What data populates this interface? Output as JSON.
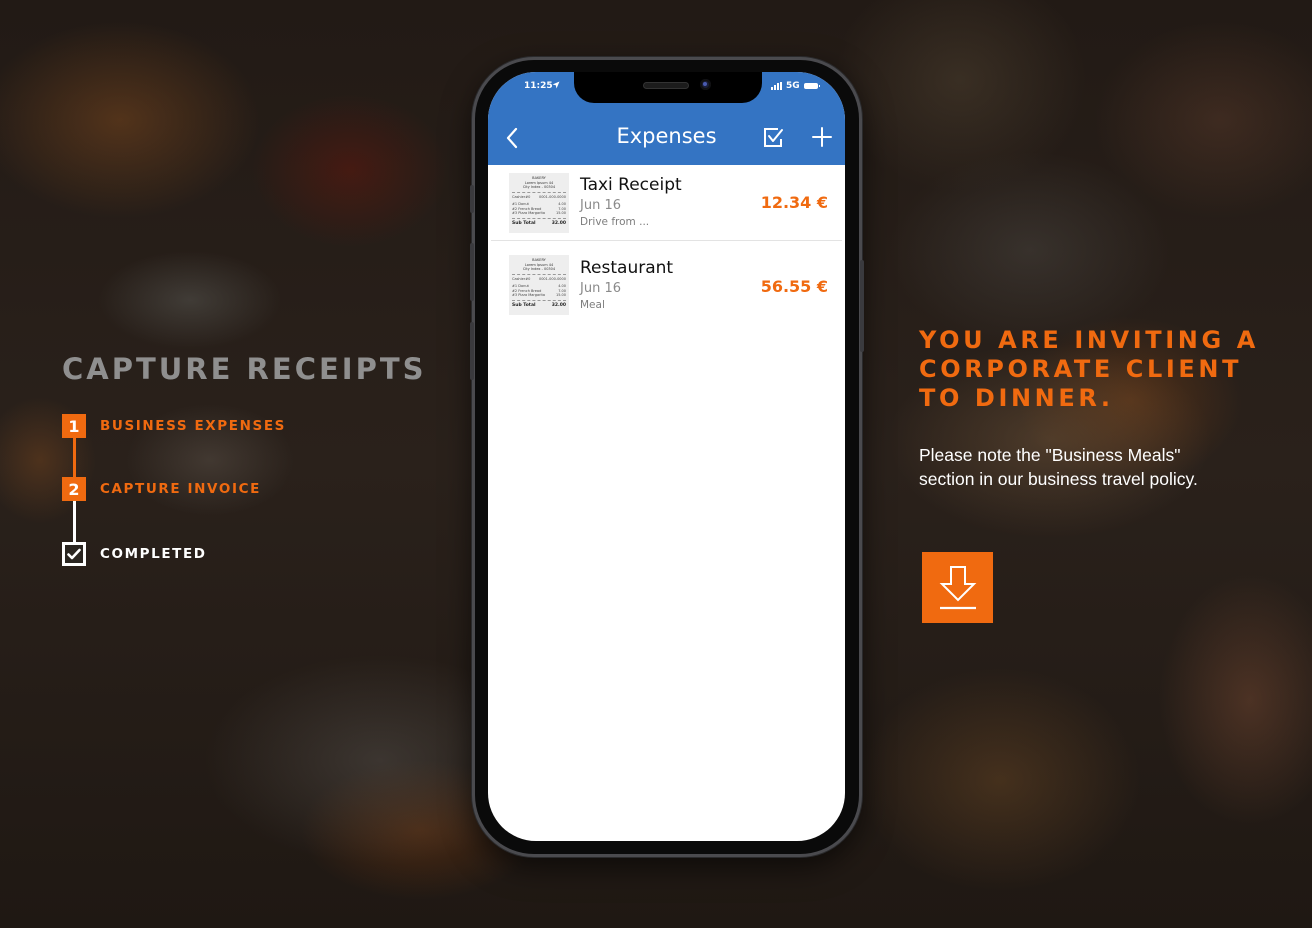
{
  "left_panel": {
    "title": "CAPTURE RECEIPTS",
    "steps": [
      {
        "badge": "1",
        "label": "BUSINESS EXPENSES",
        "state": "active"
      },
      {
        "badge": "2",
        "label": "CAPTURE INVOICE",
        "state": "active"
      },
      {
        "badge": "check-icon",
        "label": "COMPLETED",
        "state": "completed"
      }
    ]
  },
  "phone": {
    "status_bar": {
      "time": "11:25",
      "network": "5G",
      "icons": [
        "location-arrow-icon",
        "signal-icon",
        "battery-icon"
      ]
    },
    "nav": {
      "title": "Expenses",
      "left_icon": "chevron-left-icon",
      "right_icons": [
        "checkbox-select-icon",
        "plus-icon"
      ]
    },
    "receipt_thumb": {
      "header": [
        "BAKERY",
        "Lorem Ipsum 44",
        "City Index - 00304",
        "Tel.: +123-456-789-01"
      ],
      "cashier": [
        "Cashier#0",
        "0001-000-0000"
      ],
      "items": [
        [
          "#1 Donut",
          "2",
          "4.00"
        ],
        [
          "#2 French Bread",
          "1",
          "7.00"
        ],
        [
          "#3 Pizza Margarita",
          "1",
          "15.00"
        ]
      ],
      "total": [
        "Sub Total",
        "32.00"
      ]
    },
    "expenses": [
      {
        "title": "Taxi Receipt",
        "date": "Jun 16",
        "note": "Drive from ...",
        "amount": "12.34 €"
      },
      {
        "title": "Restaurant",
        "date": "Jun 16",
        "note": "Meal",
        "amount": "56.55 €"
      }
    ]
  },
  "right_panel": {
    "headline": [
      "YOU ARE INVITING A",
      "CORPORATE CLIENT",
      "TO DINNER."
    ],
    "description": "Please note the \"Business Meals\" section in our business travel policy.",
    "download_icon": "download-icon"
  },
  "colors": {
    "accent": "#f06a10",
    "nav_blue": "#3474c3",
    "title_gray": "#8f8f8f"
  }
}
